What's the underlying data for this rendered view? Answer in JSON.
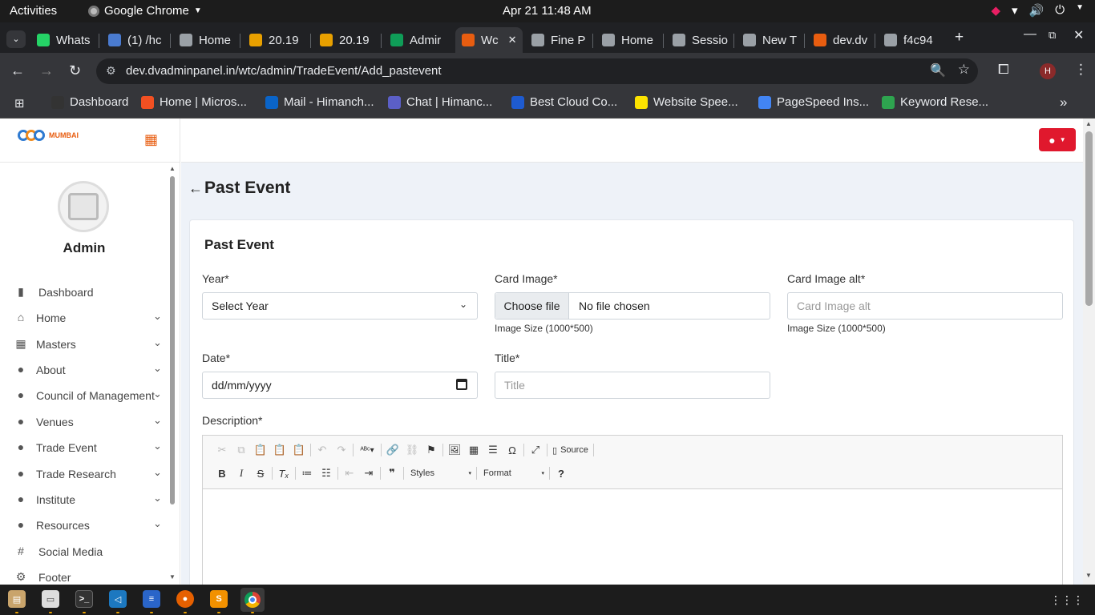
{
  "system_bar": {
    "activities": "Activities",
    "app_name": "Google Chrome",
    "clock": "Apr 21  11:48 AM"
  },
  "tabs": [
    {
      "label": "Whats",
      "icon": "whatsapp-icon",
      "color": "#25d366"
    },
    {
      "label": "(1) /hc",
      "icon": "notification-icon",
      "color": "#4a7bd0"
    },
    {
      "label": "Home",
      "icon": "globe-icon",
      "color": "#9aa0a6"
    },
    {
      "label": "20.19",
      "icon": "site-icon",
      "color": "#e8a000"
    },
    {
      "label": "20.19",
      "icon": "site-icon",
      "color": "#e8a000"
    },
    {
      "label": "Admir",
      "icon": "sheets-icon",
      "color": "#0f9d58"
    },
    {
      "label": "Wc",
      "icon": "wtc-icon",
      "color": "#e85d10",
      "active": true
    },
    {
      "label": "Fine P",
      "icon": "globe-icon",
      "color": "#9aa0a6"
    },
    {
      "label": "Home",
      "icon": "globe-icon",
      "color": "#9aa0a6"
    },
    {
      "label": "Sessio",
      "icon": "chatgpt-icon",
      "color": "#9aa0a6"
    },
    {
      "label": "New T",
      "icon": "chrome-icon",
      "color": "#9aa0a6"
    },
    {
      "label": "dev.dv",
      "icon": "wtc-icon",
      "color": "#e85d10"
    },
    {
      "label": "f4c94",
      "icon": "globe-icon",
      "color": "#9aa0a6"
    }
  ],
  "address_bar": {
    "url": "dev.dvadminpanel.in/wtc/admin/TradeEvent/Add_pastevent",
    "profile_initial": "H"
  },
  "bookmarks": [
    {
      "label": "Dashboard",
      "icon": "dv-icon",
      "color": "#333"
    },
    {
      "label": "Home | Micros...",
      "icon": "microsoft-icon",
      "color": "#f25022"
    },
    {
      "label": "Mail - Himanch...",
      "icon": "outlook-icon",
      "color": "#0a64c8"
    },
    {
      "label": "Chat | Himanc...",
      "icon": "teams-icon",
      "color": "#5b5fc7"
    },
    {
      "label": "Best Cloud Co...",
      "icon": "cloud-icon",
      "color": "#1e5bd0"
    },
    {
      "label": "Website Spee...",
      "icon": "pingdom-icon",
      "color": "#fce300"
    },
    {
      "label": "PageSpeed Ins...",
      "icon": "pagespeed-icon",
      "color": "#4285f4"
    },
    {
      "label": "Keyword Rese...",
      "icon": "keyword-icon",
      "color": "#2ea44f"
    }
  ],
  "sidebar": {
    "brand_text": "MUMBAI",
    "admin_name": "Admin",
    "items": [
      {
        "label": "Dashboard",
        "icon": "bar-chart-icon",
        "expandable": false
      },
      {
        "label": "Home",
        "icon": "home-icon",
        "expandable": true
      },
      {
        "label": "Masters",
        "icon": "table-icon",
        "expandable": true
      },
      {
        "label": "About",
        "icon": "user-icon",
        "expandable": true
      },
      {
        "label": "Council of Management",
        "icon": "user-icon",
        "expandable": true
      },
      {
        "label": "Venues",
        "icon": "user-icon",
        "expandable": true
      },
      {
        "label": "Trade Event",
        "icon": "user-icon",
        "expandable": true
      },
      {
        "label": "Trade Research",
        "icon": "user-icon",
        "expandable": true
      },
      {
        "label": "Institute",
        "icon": "user-icon",
        "expandable": true
      },
      {
        "label": "Resources",
        "icon": "user-icon",
        "expandable": true
      },
      {
        "label": "Social Media",
        "icon": "hash-icon",
        "expandable": false
      },
      {
        "label": "Footer",
        "icon": "footer-icon",
        "expandable": false
      }
    ]
  },
  "main": {
    "page_title": "Past Event",
    "card_title": "Past Event",
    "form": {
      "year_label": "Year*",
      "year_value": "Select Year",
      "card_image_label": "Card Image*",
      "choose_file": "Choose file",
      "no_file": "No file chosen",
      "image_size_hint": "Image Size (1000*500)",
      "card_image_alt_label": "Card Image alt*",
      "card_image_alt_placeholder": "Card Image alt",
      "image_size_hint_alt": "Image Size (1000*500)",
      "date_label": "Date*",
      "date_placeholder": "dd/mm/yyyy",
      "title_label": "Title*",
      "title_placeholder": "Title",
      "description_label": "Description*"
    },
    "editor": {
      "source_label": "Source",
      "styles_label": "Styles",
      "format_label": "Format"
    }
  },
  "accent_colors": {
    "user_button": "#e0182d",
    "main_bg": "#eef2f8"
  }
}
